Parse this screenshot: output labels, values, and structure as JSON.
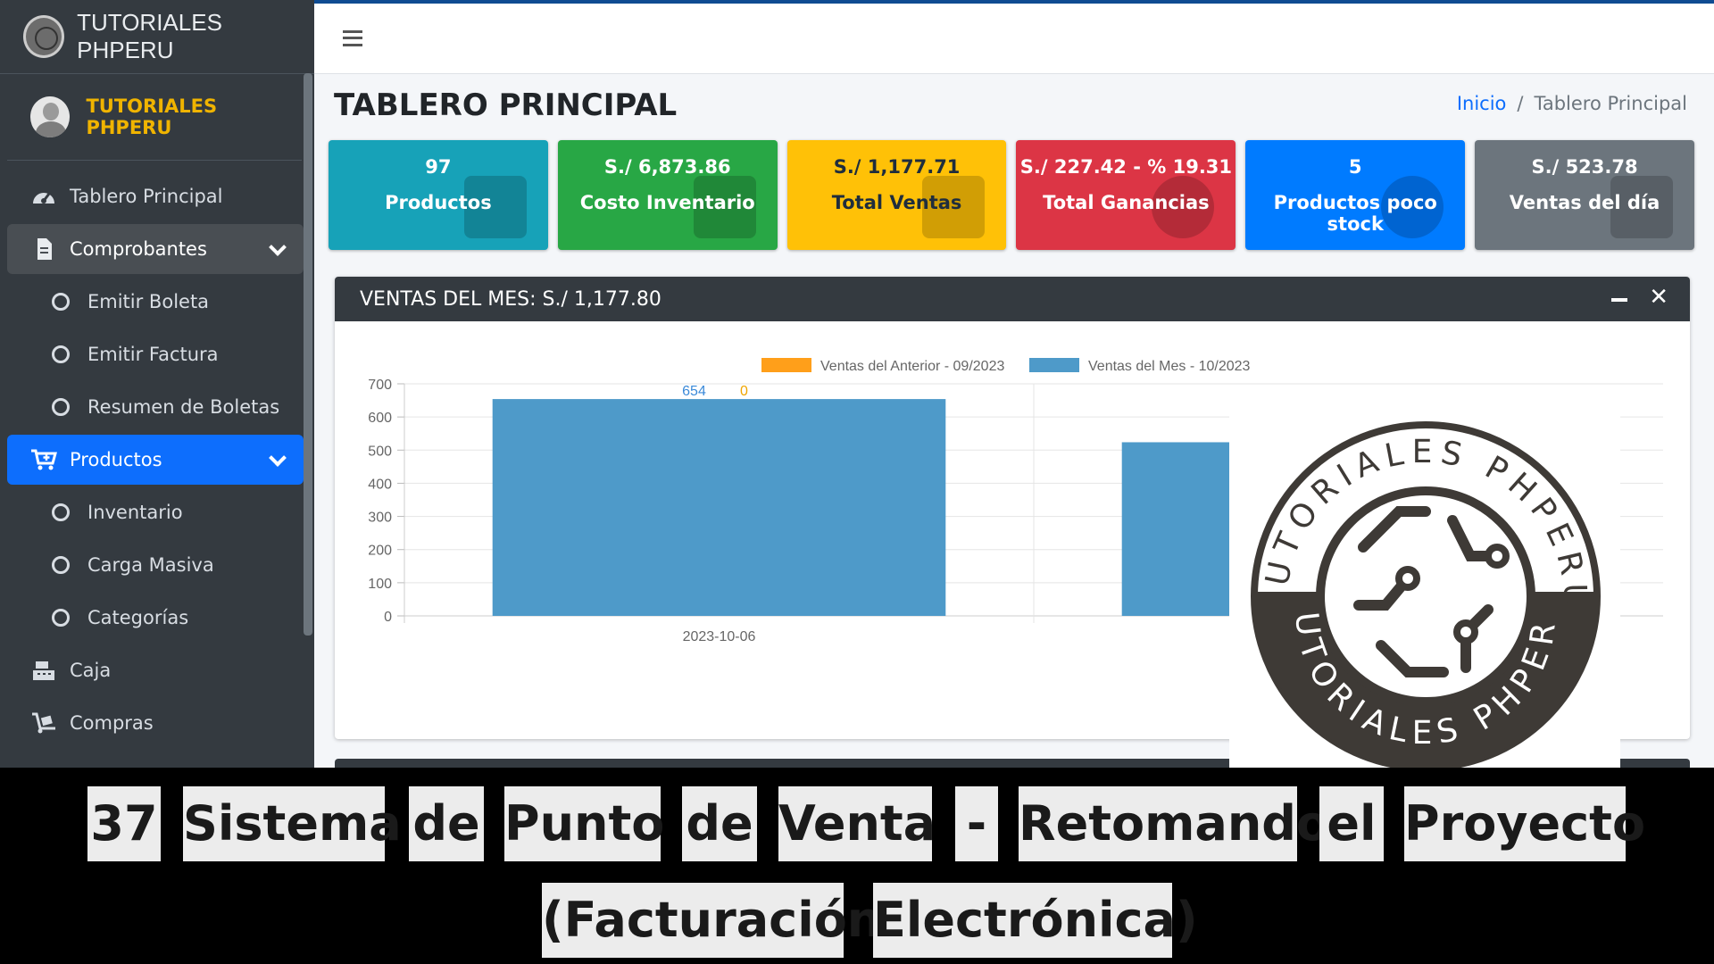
{
  "app": {
    "brand": "TUTORIALES PHPERU",
    "user_name": "TUTORIALES PHPERU"
  },
  "sidebar": {
    "items": [
      {
        "label": "Tablero Principal",
        "icon": "gauge-icon"
      },
      {
        "label": "Comprobantes",
        "icon": "file-invoice-icon"
      },
      {
        "label": "Emitir Boleta",
        "icon": "circle-icon"
      },
      {
        "label": "Emitir Factura",
        "icon": "circle-icon"
      },
      {
        "label": "Resumen de Boletas",
        "icon": "circle-icon"
      },
      {
        "label": "Productos",
        "icon": "cart-plus-icon"
      },
      {
        "label": "Inventario",
        "icon": "circle-icon"
      },
      {
        "label": "Carga Masiva",
        "icon": "circle-icon"
      },
      {
        "label": "Categorías",
        "icon": "circle-icon"
      },
      {
        "label": "Caja",
        "icon": "cash-register-icon"
      },
      {
        "label": "Compras",
        "icon": "dolly-icon"
      }
    ]
  },
  "header": {
    "page_title": "TABLERO PRINCIPAL",
    "breadcrumb_home": "Inicio",
    "breadcrumb_sep": "/",
    "breadcrumb_current": "Tablero Principal"
  },
  "boxes": [
    {
      "value": "97",
      "label": "Productos",
      "color": "#17a2b8"
    },
    {
      "value": "S./ 6,873.86",
      "label": "Costo Inventario",
      "color": "#28a745"
    },
    {
      "value": "S./ 1,177.71",
      "label": "Total Ventas",
      "color": "#ffc107"
    },
    {
      "value": "S./ 227.42 - % 19.31",
      "label": "Total Ganancias",
      "color": "#dc3545"
    },
    {
      "value": "5",
      "label": "Productos poco stock",
      "color": "#007bff"
    },
    {
      "value": "S./ 523.78",
      "label": "Ventas del día",
      "color": "#6c757d"
    }
  ],
  "sales_card": {
    "title": "VENTAS DEL MES: S./ 1,177.80",
    "minimize_symbol": "—",
    "close_symbol": "✕"
  },
  "chart_data": {
    "type": "bar",
    "categories": [
      "2023-10-06",
      ""
    ],
    "series": [
      {
        "name": "Ventas del Anterior - 09/2023",
        "color": "#ff9f1a",
        "values": [
          0,
          0
        ]
      },
      {
        "name": "Ventas del Mes - 10/2023",
        "color": "#4e9ac9",
        "values": [
          654,
          523.78
        ]
      }
    ],
    "data_labels": [
      "654",
      "0"
    ],
    "ylim": [
      0,
      700
    ],
    "yticks": [
      "0",
      "100",
      "200",
      "300",
      "400",
      "500",
      "600",
      "700"
    ],
    "grid": true,
    "legend": "top-center"
  },
  "logo_watermark": {
    "top_text": "TUTORIALES PHPERU",
    "bottom_text": "TUTORIALES PHPERU"
  },
  "caption": {
    "words": [
      "37",
      "Sistema",
      "de",
      "Punto",
      "de",
      "Venta",
      "-",
      "Retomando",
      "el",
      "Proyecto",
      "(Facturación",
      "Electrónica)"
    ]
  }
}
